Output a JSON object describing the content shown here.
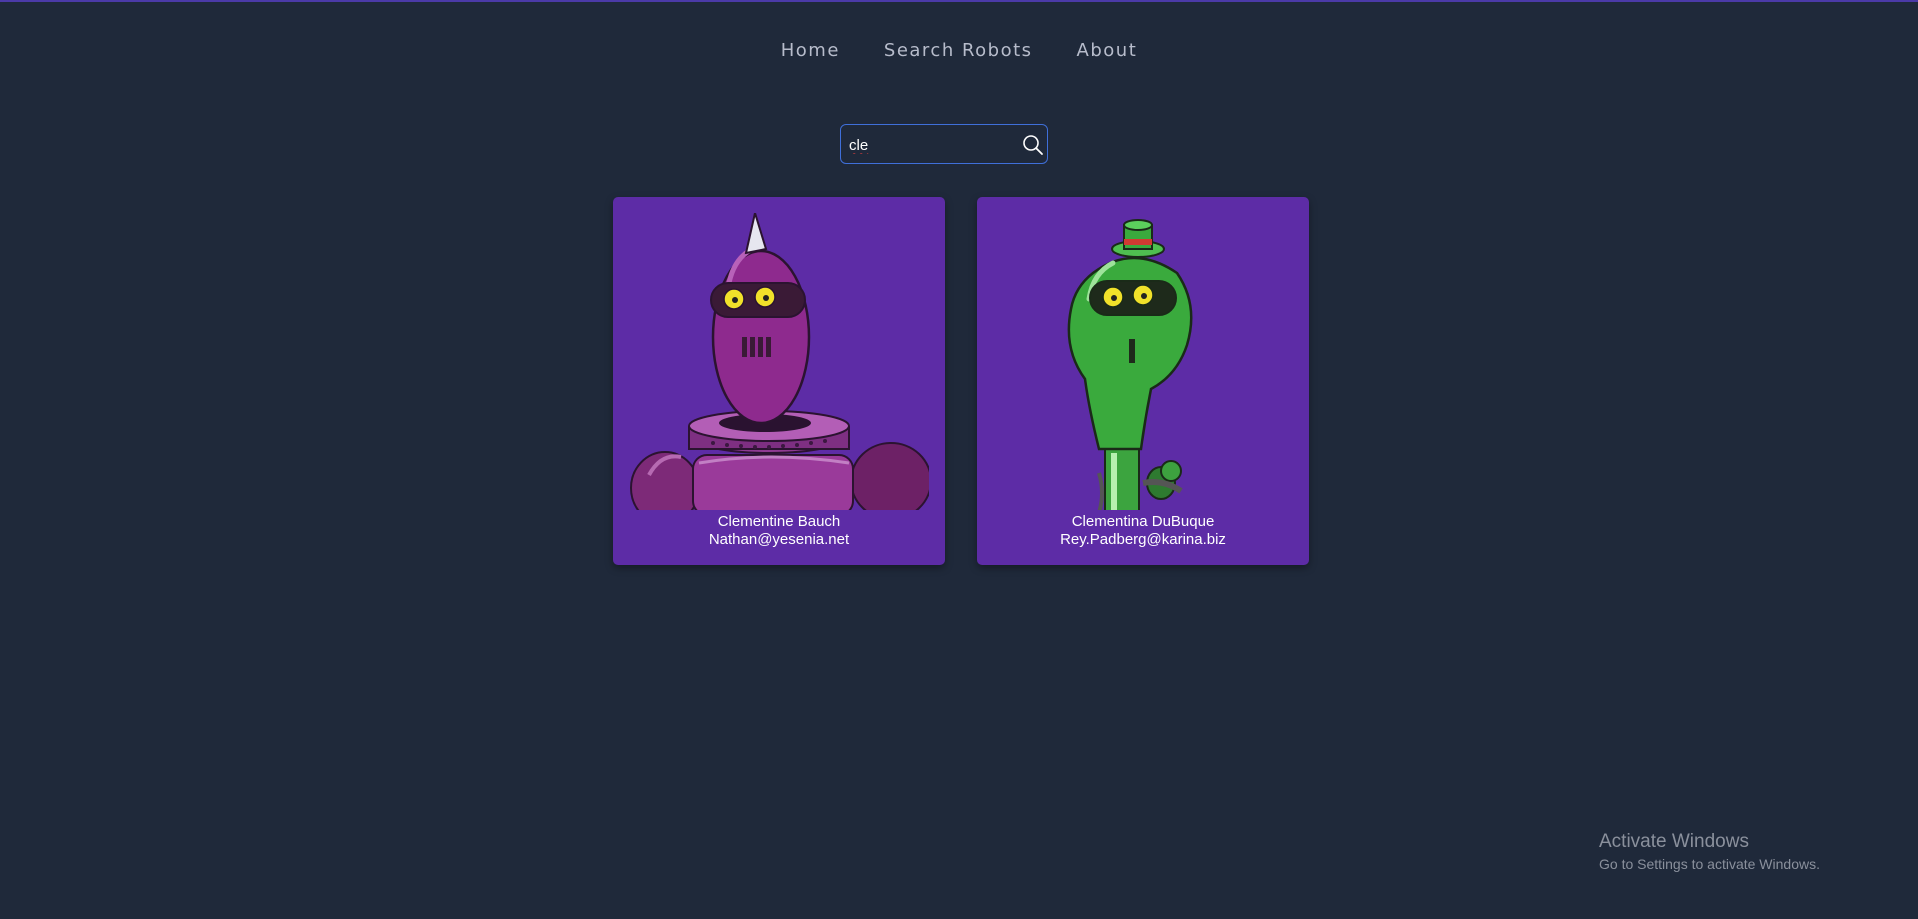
{
  "nav": {
    "items": [
      {
        "label": "Home"
      },
      {
        "label": "Search Robots"
      },
      {
        "label": "About"
      }
    ]
  },
  "search": {
    "value": "cle",
    "icon": "search-icon"
  },
  "robots": [
    {
      "name": "Clementine Bauch",
      "email": "Nathan@yesenia.net",
      "image": "purple-robot"
    },
    {
      "name": "Clementina DuBuque",
      "email": "Rey.Padberg@karina.biz",
      "image": "green-robot"
    }
  ],
  "colors": {
    "background": "#1f293a",
    "card": "#5d2ca6",
    "search_border": "#3f6fd9",
    "nav_text": "#b7bccb"
  },
  "watermark": {
    "title": "Activate Windows",
    "subtitle": "Go to Settings to activate Windows."
  }
}
